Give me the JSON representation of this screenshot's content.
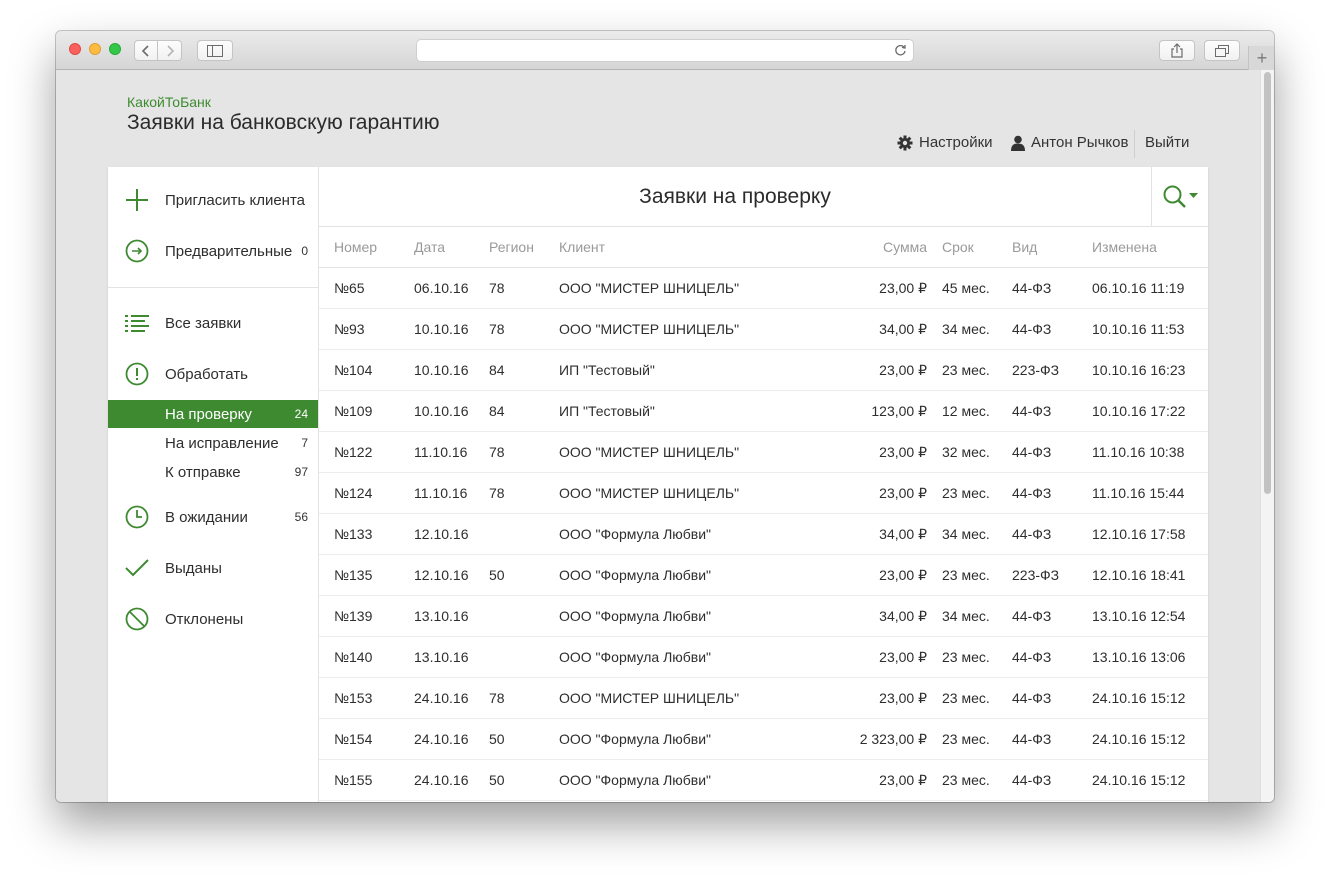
{
  "browser": {
    "url_text": "",
    "icons": [
      "back-icon",
      "forward-icon",
      "sidebar-icon",
      "reload-icon",
      "share-icon",
      "tabs-icon",
      "new-tab-icon"
    ],
    "new_tab_label": "+"
  },
  "header": {
    "brand": "КакойТоБанк",
    "title": "Заявки на банковскую гарантию",
    "settings_label": "Настройки",
    "user_name": "Антон Рычков",
    "logout_label": "Выйти"
  },
  "sidebar": {
    "invite_label": "Пригласить клиента",
    "preliminary_label": "Предварительные",
    "preliminary_count": "0",
    "all_label": "Все заявки",
    "process_label": "Обработать",
    "sub_items": [
      {
        "label": "На проверку",
        "count": "24",
        "active": true
      },
      {
        "label": "На исправление",
        "count": "7",
        "active": false
      },
      {
        "label": "К отправке",
        "count": "97",
        "active": false
      }
    ],
    "waiting_label": "В ожидании",
    "waiting_count": "56",
    "issued_label": "Выданы",
    "rejected_label": "Отклонены"
  },
  "main": {
    "title": "Заявки на проверку",
    "columns": [
      "Номер",
      "Дата",
      "Регион",
      "Клиент",
      "Сумма",
      "Срок",
      "Вид",
      "Изменена"
    ],
    "rows": [
      [
        "№65",
        "06.10.16",
        "78",
        "ООО \"МИСТЕР ШНИЦЕЛЬ\"",
        "23,00 ₽",
        "45 мес.",
        "44-ФЗ",
        "06.10.16 11:19"
      ],
      [
        "№93",
        "10.10.16",
        "78",
        "ООО \"МИСТЕР ШНИЦЕЛЬ\"",
        "34,00 ₽",
        "34 мес.",
        "44-ФЗ",
        "10.10.16 11:53"
      ],
      [
        "№104",
        "10.10.16",
        "84",
        "ИП \"Тестовый\"",
        "23,00 ₽",
        "23 мес.",
        "223-ФЗ",
        "10.10.16 16:23"
      ],
      [
        "№109",
        "10.10.16",
        "84",
        "ИП \"Тестовый\"",
        "123,00 ₽",
        "12 мес.",
        "44-ФЗ",
        "10.10.16 17:22"
      ],
      [
        "№122",
        "11.10.16",
        "78",
        "ООО \"МИСТЕР ШНИЦЕЛЬ\"",
        "23,00 ₽",
        "32 мес.",
        "44-ФЗ",
        "11.10.16 10:38"
      ],
      [
        "№124",
        "11.10.16",
        "78",
        "ООО \"МИСТЕР ШНИЦЕЛЬ\"",
        "23,00 ₽",
        "23 мес.",
        "44-ФЗ",
        "11.10.16 15:44"
      ],
      [
        "№133",
        "12.10.16",
        "",
        "ООО \"Формула Любви\"",
        "34,00 ₽",
        "34 мес.",
        "44-ФЗ",
        "12.10.16 17:58"
      ],
      [
        "№135",
        "12.10.16",
        "50",
        "ООО \"Формула Любви\"",
        "23,00 ₽",
        "23 мес.",
        "223-ФЗ",
        "12.10.16 18:41"
      ],
      [
        "№139",
        "13.10.16",
        "",
        "ООО \"Формула Любви\"",
        "34,00 ₽",
        "34 мес.",
        "44-ФЗ",
        "13.10.16 12:54"
      ],
      [
        "№140",
        "13.10.16",
        "",
        "ООО \"Формула Любви\"",
        "23,00 ₽",
        "23 мес.",
        "44-ФЗ",
        "13.10.16 13:06"
      ],
      [
        "№153",
        "24.10.16",
        "78",
        "ООО \"МИСТЕР ШНИЦЕЛЬ\"",
        "23,00 ₽",
        "23 мес.",
        "44-ФЗ",
        "24.10.16 15:12"
      ],
      [
        "№154",
        "24.10.16",
        "50",
        "ООО \"Формула Любви\"",
        "2 323,00 ₽",
        "23 мес.",
        "44-ФЗ",
        "24.10.16 15:12"
      ],
      [
        "№155",
        "24.10.16",
        "50",
        "ООО \"Формула Любви\"",
        "23,00 ₽",
        "23 мес.",
        "44-ФЗ",
        "24.10.16 15:12"
      ]
    ]
  },
  "colors": {
    "accent": "#3e8a31",
    "brand": "#3d8b2f",
    "background": "#e5e5e5",
    "text": "#2e2e2e",
    "muted": "#9a9a9a"
  }
}
